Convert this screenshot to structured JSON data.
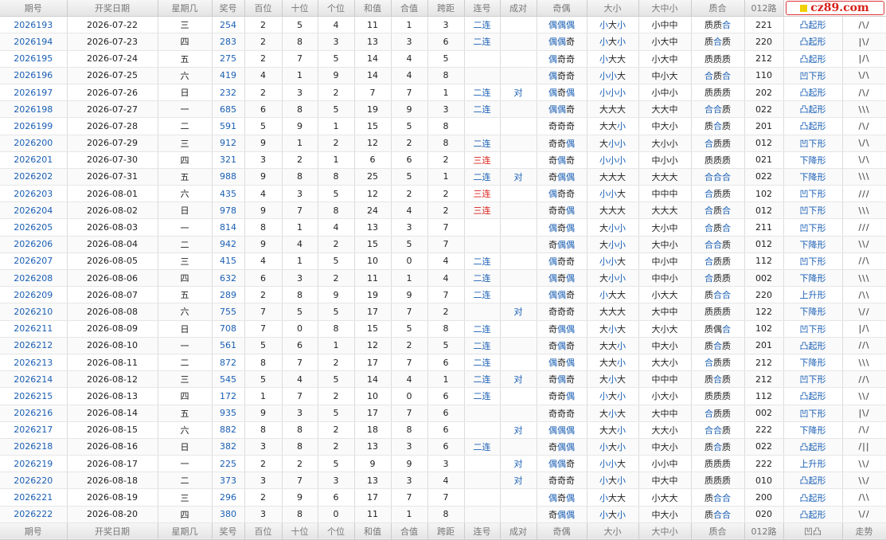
{
  "headers": [
    "期号",
    "开奖日期",
    "星期几",
    "奖号",
    "百位",
    "十位",
    "个位",
    "和值",
    "合值",
    "跨距",
    "连号",
    "成对",
    "奇偶",
    "大小",
    "大中小",
    "质合",
    "012路",
    "凹凸",
    "走势"
  ],
  "logo_text": "cz89.com",
  "rows": [
    [
      "2026193",
      "2026-07-22",
      "三",
      "254",
      "2",
      "5",
      "4",
      "11",
      "1",
      "3",
      "二连",
      "",
      "偶偶偶",
      "小大小",
      "小中中",
      "质质合",
      "221",
      "凸起形",
      "/\\/"
    ],
    [
      "2026194",
      "2026-07-23",
      "四",
      "283",
      "2",
      "8",
      "3",
      "13",
      "3",
      "6",
      "二连",
      "",
      "偶偶奇",
      "小大小",
      "小大中",
      "质合质",
      "220",
      "凸起形",
      "|\\/"
    ],
    [
      "2026195",
      "2026-07-24",
      "五",
      "275",
      "2",
      "7",
      "5",
      "14",
      "4",
      "5",
      "",
      "",
      "偶奇奇",
      "小大大",
      "小大中",
      "质质质",
      "212",
      "凸起形",
      "|/\\"
    ],
    [
      "2026196",
      "2026-07-25",
      "六",
      "419",
      "4",
      "1",
      "9",
      "14",
      "4",
      "8",
      "",
      "",
      "偶奇奇",
      "小小大",
      "中小大",
      "合质合",
      "110",
      "凹下形",
      "\\/\\"
    ],
    [
      "2026197",
      "2026-07-26",
      "日",
      "232",
      "2",
      "3",
      "2",
      "7",
      "7",
      "1",
      "二连",
      "对",
      "偶奇偶",
      "小小小",
      "小中小",
      "质质质",
      "202",
      "凸起形",
      "/\\/"
    ],
    [
      "2026198",
      "2026-07-27",
      "一",
      "685",
      "6",
      "8",
      "5",
      "19",
      "9",
      "3",
      "二连",
      "",
      "偶偶奇",
      "大大大",
      "大大中",
      "合合质",
      "022",
      "凸起形",
      "\\\\\\"
    ],
    [
      "2026199",
      "2026-07-28",
      "二",
      "591",
      "5",
      "9",
      "1",
      "15",
      "5",
      "8",
      "",
      "",
      "奇奇奇",
      "大大小",
      "中大小",
      "质合质",
      "201",
      "凸起形",
      "/\\/"
    ],
    [
      "2026200",
      "2026-07-29",
      "三",
      "912",
      "9",
      "1",
      "2",
      "12",
      "2",
      "8",
      "二连",
      "",
      "奇奇偶",
      "大小小",
      "大小小",
      "合质质",
      "012",
      "凹下形",
      "\\/\\"
    ],
    [
      "2026201",
      "2026-07-30",
      "四",
      "321",
      "3",
      "2",
      "1",
      "6",
      "6",
      "2",
      "三连",
      "",
      "奇偶奇",
      "小小小",
      "中小小",
      "质质质",
      "021",
      "下降形",
      "\\/\\"
    ],
    [
      "2026202",
      "2026-07-31",
      "五",
      "988",
      "9",
      "8",
      "8",
      "25",
      "5",
      "1",
      "二连",
      "对",
      "奇偶偶",
      "大大大",
      "大大大",
      "合合合",
      "022",
      "下降形",
      "\\\\\\"
    ],
    [
      "2026203",
      "2026-08-01",
      "六",
      "435",
      "4",
      "3",
      "5",
      "12",
      "2",
      "2",
      "三连",
      "",
      "偶奇奇",
      "小小大",
      "中中中",
      "合质质",
      "102",
      "凹下形",
      "///"
    ],
    [
      "2026204",
      "2026-08-02",
      "日",
      "978",
      "9",
      "7",
      "8",
      "24",
      "4",
      "2",
      "三连",
      "",
      "奇奇偶",
      "大大大",
      "大大大",
      "合质合",
      "012",
      "凹下形",
      "\\\\\\"
    ],
    [
      "2026205",
      "2026-08-03",
      "一",
      "814",
      "8",
      "1",
      "4",
      "13",
      "3",
      "7",
      "",
      "",
      "偶奇偶",
      "大小小",
      "大小中",
      "合质合",
      "211",
      "凹下形",
      "///"
    ],
    [
      "2026206",
      "2026-08-04",
      "二",
      "942",
      "9",
      "4",
      "2",
      "15",
      "5",
      "7",
      "",
      "",
      "奇偶偶",
      "大小小",
      "大中小",
      "合合质",
      "012",
      "下降形",
      "\\\\/"
    ],
    [
      "2026207",
      "2026-08-05",
      "三",
      "415",
      "4",
      "1",
      "5",
      "10",
      "0",
      "4",
      "二连",
      "",
      "偶奇奇",
      "小小大",
      "中小中",
      "合质质",
      "112",
      "凹下形",
      "//\\"
    ],
    [
      "2026208",
      "2026-08-06",
      "四",
      "632",
      "6",
      "3",
      "2",
      "11",
      "1",
      "4",
      "二连",
      "",
      "偶奇偶",
      "大小小",
      "中中小",
      "合质质",
      "002",
      "下降形",
      "\\\\\\"
    ],
    [
      "2026209",
      "2026-08-07",
      "五",
      "289",
      "2",
      "8",
      "9",
      "19",
      "9",
      "7",
      "二连",
      "",
      "偶偶奇",
      "小大大",
      "小大大",
      "质合合",
      "220",
      "上升形",
      "/\\\\"
    ],
    [
      "2026210",
      "2026-08-08",
      "六",
      "755",
      "7",
      "5",
      "5",
      "17",
      "7",
      "2",
      "",
      "对",
      "奇奇奇",
      "大大大",
      "大中中",
      "质质质",
      "122",
      "下降形",
      "\\//"
    ],
    [
      "2026211",
      "2026-08-09",
      "日",
      "708",
      "7",
      "0",
      "8",
      "15",
      "5",
      "8",
      "二连",
      "",
      "奇偶偶",
      "大小大",
      "大小大",
      "质偶合",
      "102",
      "凹下形",
      "|/\\"
    ],
    [
      "2026212",
      "2026-08-10",
      "一",
      "561",
      "5",
      "6",
      "1",
      "12",
      "2",
      "5",
      "二连",
      "",
      "奇偶奇",
      "大大小",
      "中大小",
      "质合质",
      "201",
      "凸起形",
      "//\\"
    ],
    [
      "2026213",
      "2026-08-11",
      "二",
      "872",
      "8",
      "7",
      "2",
      "17",
      "7",
      "6",
      "二连",
      "",
      "偶奇偶",
      "大大小",
      "大大小",
      "合质质",
      "212",
      "下降形",
      "\\\\\\"
    ],
    [
      "2026214",
      "2026-08-12",
      "三",
      "545",
      "5",
      "4",
      "5",
      "14",
      "4",
      "1",
      "二连",
      "对",
      "奇偶奇",
      "大小大",
      "中中中",
      "质合质",
      "212",
      "凹下形",
      "//\\"
    ],
    [
      "2026215",
      "2026-08-13",
      "四",
      "172",
      "1",
      "7",
      "2",
      "10",
      "0",
      "6",
      "二连",
      "",
      "奇奇偶",
      "小大小",
      "小大小",
      "质质质",
      "112",
      "凸起形",
      "\\\\/"
    ],
    [
      "2026216",
      "2026-08-14",
      "五",
      "935",
      "9",
      "3",
      "5",
      "17",
      "7",
      "6",
      "",
      "",
      "奇奇奇",
      "大小大",
      "大中中",
      "合质质",
      "002",
      "凹下形",
      "|\\/"
    ],
    [
      "2026217",
      "2026-08-15",
      "六",
      "882",
      "8",
      "8",
      "2",
      "18",
      "8",
      "6",
      "",
      "对",
      "偶偶偶",
      "大大小",
      "大大小",
      "合合质",
      "222",
      "下降形",
      "/\\/"
    ],
    [
      "2026218",
      "2026-08-16",
      "日",
      "382",
      "3",
      "8",
      "2",
      "13",
      "3",
      "6",
      "二连",
      "",
      "奇偶偶",
      "小大小",
      "中大小",
      "质合质",
      "022",
      "凸起形",
      "/||"
    ],
    [
      "2026219",
      "2026-08-17",
      "一",
      "225",
      "2",
      "2",
      "5",
      "9",
      "9",
      "3",
      "",
      "对",
      "偶偶奇",
      "小小大",
      "小小中",
      "质质质",
      "222",
      "上升形",
      "\\\\/"
    ],
    [
      "2026220",
      "2026-08-18",
      "二",
      "373",
      "3",
      "7",
      "3",
      "13",
      "3",
      "4",
      "",
      "对",
      "奇奇奇",
      "小大小",
      "中大中",
      "质质质",
      "010",
      "凸起形",
      "\\\\/"
    ],
    [
      "2026221",
      "2026-08-19",
      "三",
      "296",
      "2",
      "9",
      "6",
      "17",
      "7",
      "7",
      "",
      "",
      "偶奇偶",
      "小大大",
      "小大大",
      "质合合",
      "200",
      "凸起形",
      "/\\\\"
    ],
    [
      "2026222",
      "2026-08-20",
      "四",
      "380",
      "3",
      "8",
      "0",
      "11",
      "1",
      "8",
      "",
      "",
      "奇偶偶",
      "小大小",
      "中大小",
      "质合合",
      "020",
      "凸起形",
      "\\//"
    ]
  ]
}
